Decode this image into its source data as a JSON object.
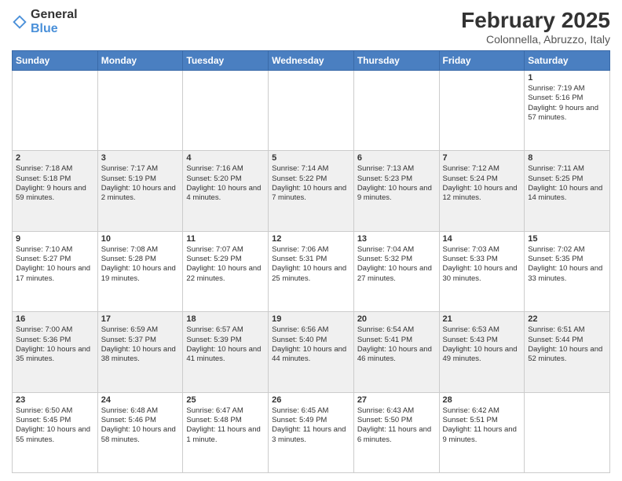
{
  "logo": {
    "general": "General",
    "blue": "Blue"
  },
  "header": {
    "month_year": "February 2025",
    "location": "Colonnella, Abruzzo, Italy"
  },
  "weekdays": [
    "Sunday",
    "Monday",
    "Tuesday",
    "Wednesday",
    "Thursday",
    "Friday",
    "Saturday"
  ],
  "weeks": [
    [
      {
        "day": "",
        "info": ""
      },
      {
        "day": "",
        "info": ""
      },
      {
        "day": "",
        "info": ""
      },
      {
        "day": "",
        "info": ""
      },
      {
        "day": "",
        "info": ""
      },
      {
        "day": "",
        "info": ""
      },
      {
        "day": "1",
        "info": "Sunrise: 7:19 AM\nSunset: 5:16 PM\nDaylight: 9 hours and 57 minutes."
      }
    ],
    [
      {
        "day": "2",
        "info": "Sunrise: 7:18 AM\nSunset: 5:18 PM\nDaylight: 9 hours and 59 minutes."
      },
      {
        "day": "3",
        "info": "Sunrise: 7:17 AM\nSunset: 5:19 PM\nDaylight: 10 hours and 2 minutes."
      },
      {
        "day": "4",
        "info": "Sunrise: 7:16 AM\nSunset: 5:20 PM\nDaylight: 10 hours and 4 minutes."
      },
      {
        "day": "5",
        "info": "Sunrise: 7:14 AM\nSunset: 5:22 PM\nDaylight: 10 hours and 7 minutes."
      },
      {
        "day": "6",
        "info": "Sunrise: 7:13 AM\nSunset: 5:23 PM\nDaylight: 10 hours and 9 minutes."
      },
      {
        "day": "7",
        "info": "Sunrise: 7:12 AM\nSunset: 5:24 PM\nDaylight: 10 hours and 12 minutes."
      },
      {
        "day": "8",
        "info": "Sunrise: 7:11 AM\nSunset: 5:25 PM\nDaylight: 10 hours and 14 minutes."
      }
    ],
    [
      {
        "day": "9",
        "info": "Sunrise: 7:10 AM\nSunset: 5:27 PM\nDaylight: 10 hours and 17 minutes."
      },
      {
        "day": "10",
        "info": "Sunrise: 7:08 AM\nSunset: 5:28 PM\nDaylight: 10 hours and 19 minutes."
      },
      {
        "day": "11",
        "info": "Sunrise: 7:07 AM\nSunset: 5:29 PM\nDaylight: 10 hours and 22 minutes."
      },
      {
        "day": "12",
        "info": "Sunrise: 7:06 AM\nSunset: 5:31 PM\nDaylight: 10 hours and 25 minutes."
      },
      {
        "day": "13",
        "info": "Sunrise: 7:04 AM\nSunset: 5:32 PM\nDaylight: 10 hours and 27 minutes."
      },
      {
        "day": "14",
        "info": "Sunrise: 7:03 AM\nSunset: 5:33 PM\nDaylight: 10 hours and 30 minutes."
      },
      {
        "day": "15",
        "info": "Sunrise: 7:02 AM\nSunset: 5:35 PM\nDaylight: 10 hours and 33 minutes."
      }
    ],
    [
      {
        "day": "16",
        "info": "Sunrise: 7:00 AM\nSunset: 5:36 PM\nDaylight: 10 hours and 35 minutes."
      },
      {
        "day": "17",
        "info": "Sunrise: 6:59 AM\nSunset: 5:37 PM\nDaylight: 10 hours and 38 minutes."
      },
      {
        "day": "18",
        "info": "Sunrise: 6:57 AM\nSunset: 5:39 PM\nDaylight: 10 hours and 41 minutes."
      },
      {
        "day": "19",
        "info": "Sunrise: 6:56 AM\nSunset: 5:40 PM\nDaylight: 10 hours and 44 minutes."
      },
      {
        "day": "20",
        "info": "Sunrise: 6:54 AM\nSunset: 5:41 PM\nDaylight: 10 hours and 46 minutes."
      },
      {
        "day": "21",
        "info": "Sunrise: 6:53 AM\nSunset: 5:43 PM\nDaylight: 10 hours and 49 minutes."
      },
      {
        "day": "22",
        "info": "Sunrise: 6:51 AM\nSunset: 5:44 PM\nDaylight: 10 hours and 52 minutes."
      }
    ],
    [
      {
        "day": "23",
        "info": "Sunrise: 6:50 AM\nSunset: 5:45 PM\nDaylight: 10 hours and 55 minutes."
      },
      {
        "day": "24",
        "info": "Sunrise: 6:48 AM\nSunset: 5:46 PM\nDaylight: 10 hours and 58 minutes."
      },
      {
        "day": "25",
        "info": "Sunrise: 6:47 AM\nSunset: 5:48 PM\nDaylight: 11 hours and 1 minute."
      },
      {
        "day": "26",
        "info": "Sunrise: 6:45 AM\nSunset: 5:49 PM\nDaylight: 11 hours and 3 minutes."
      },
      {
        "day": "27",
        "info": "Sunrise: 6:43 AM\nSunset: 5:50 PM\nDaylight: 11 hours and 6 minutes."
      },
      {
        "day": "28",
        "info": "Sunrise: 6:42 AM\nSunset: 5:51 PM\nDaylight: 11 hours and 9 minutes."
      },
      {
        "day": "",
        "info": ""
      }
    ]
  ]
}
